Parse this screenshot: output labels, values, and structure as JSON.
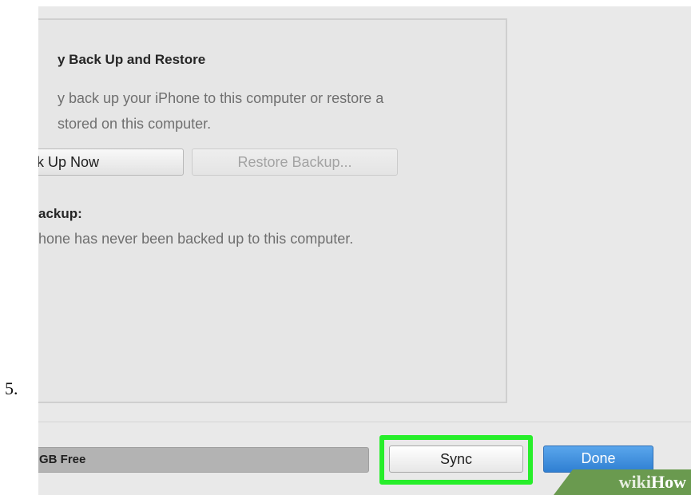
{
  "step_number": "5.",
  "backup_section": {
    "title": "y Back Up and Restore",
    "description_line1": "y back up your iPhone to this computer or restore a",
    "description_line2": "stored on this computer.",
    "back_up_now_label": "ck Up Now",
    "restore_backup_label": "Restore Backup...",
    "latest_backup_label": "ackup:",
    "latest_backup_text": "hone has never been backed up to this computer."
  },
  "footer": {
    "capacity_label": "GB Free",
    "sync_label": "Sync",
    "done_label": "Done",
    "sync_highlight_color": "#27ee2a",
    "done_color": "#3a8ee0"
  },
  "watermark": {
    "wiki": "wiki",
    "how": "How"
  }
}
